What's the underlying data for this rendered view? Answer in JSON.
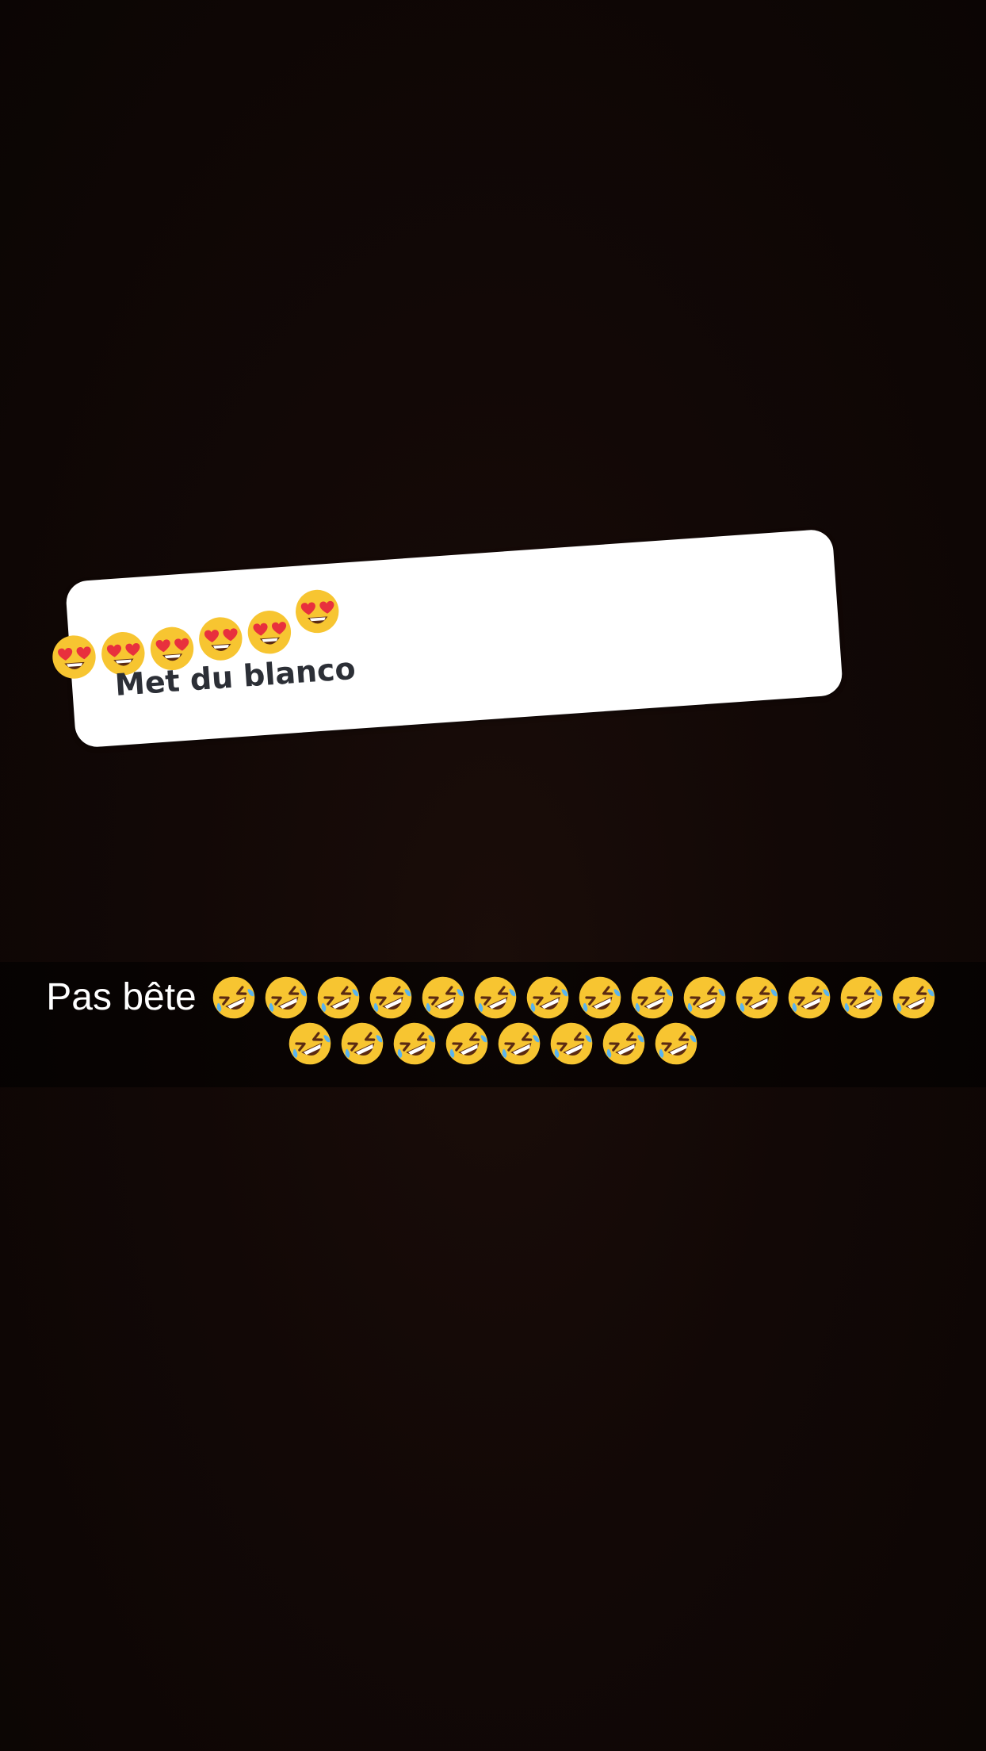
{
  "sticker": {
    "text": "Met du blanco",
    "emoji": "heart-eyes-emoji",
    "emoji_count": 6
  },
  "caption": {
    "text": "Pas bête",
    "emoji": "rolling-on-floor-laughing-emoji",
    "line1_emoji_count": 14,
    "line2_emoji_count": 8
  },
  "colors": {
    "background": "#120806",
    "sticker_bg": "#ffffff",
    "sticker_text": "#2c2f36",
    "caption_text": "#ffffff",
    "emoji_face": "#f7c531",
    "heart": "#e8303d",
    "tear": "#5ab4ee"
  }
}
